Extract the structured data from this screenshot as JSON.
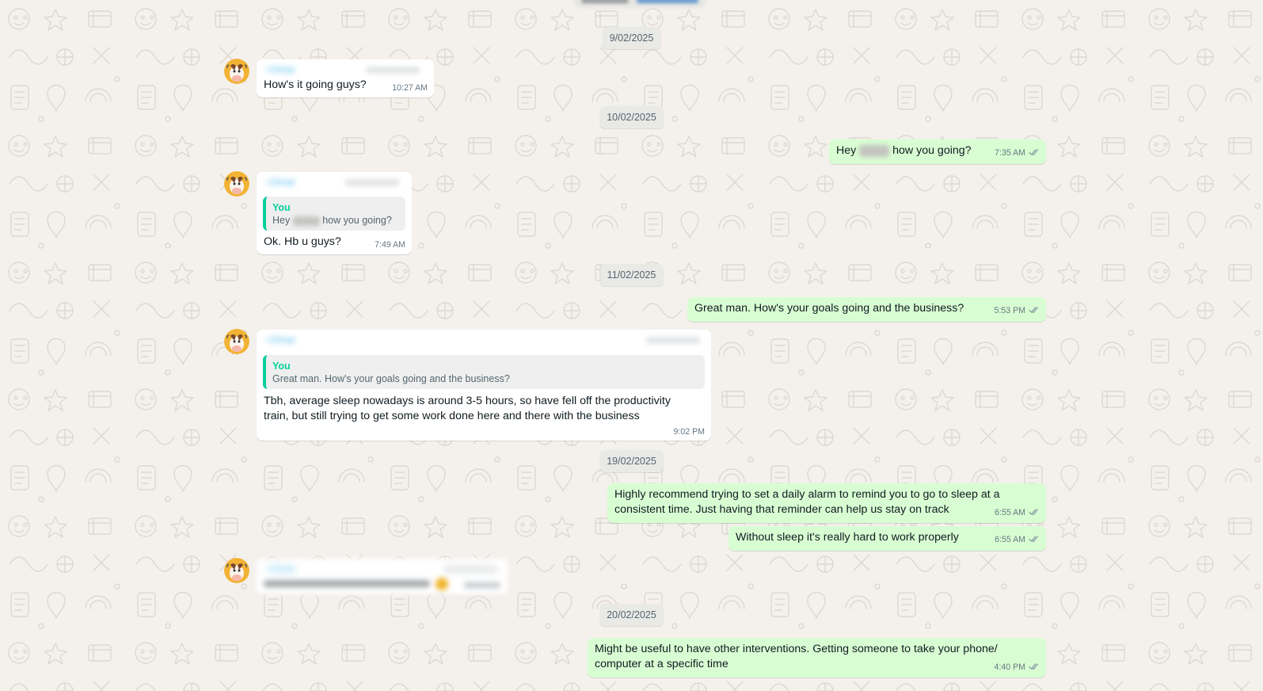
{
  "quote_label": "You",
  "date_separators": [
    "9/02/2025",
    "10/02/2025",
    "11/02/2025",
    "19/02/2025",
    "20/02/2025"
  ],
  "messages": [
    {
      "text": "How's it going guys?",
      "time": "10:27 AM"
    },
    {
      "text_before": "Hey",
      "text_after": "how you going?",
      "time": "7:35 AM"
    },
    {
      "quote": {
        "text_before": "Hey",
        "text_after": "how you going?"
      },
      "text": "Ok. Hb u guys?",
      "time": "7:49 AM"
    },
    {
      "text": "Great man. How's your goals going and the business?",
      "time": "5:53 PM"
    },
    {
      "quote": {
        "text": "Great man. How's your goals going and the business?"
      },
      "lines": [
        "Tbh, average sleep nowadays is around 3-5 hours, so have fell off the productivity",
        "train, but still trying to get some work done here and there with the business"
      ],
      "time": "9:02 PM"
    },
    {
      "lines": [
        "Highly recommend trying to set a daily alarm to remind you to go to sleep at a",
        "consistent time. Just having that reminder can help us stay on track"
      ],
      "time": "6:55 AM"
    },
    {
      "text": "Without sleep it's really hard to work properly",
      "time": "6:55 AM"
    },
    {
      "lines": [
        "Might be useful to have other interventions. Getting someone to take your phone/",
        "computer at a specific time"
      ],
      "time": "4:40 PM"
    }
  ],
  "colors": {
    "chat_background": "#f4f1ec",
    "incoming_bubble": "#ffffff",
    "outgoing_bubble": "#d9fdd3",
    "date_chip": "#e9e9e6",
    "quote_accent": "#06cf9c",
    "sender_name": "#53bdeb",
    "read_ticks": "#8696a0"
  },
  "icons": {
    "avatar": "cow-avatar-icon",
    "read_receipt": "double-check-icon"
  }
}
